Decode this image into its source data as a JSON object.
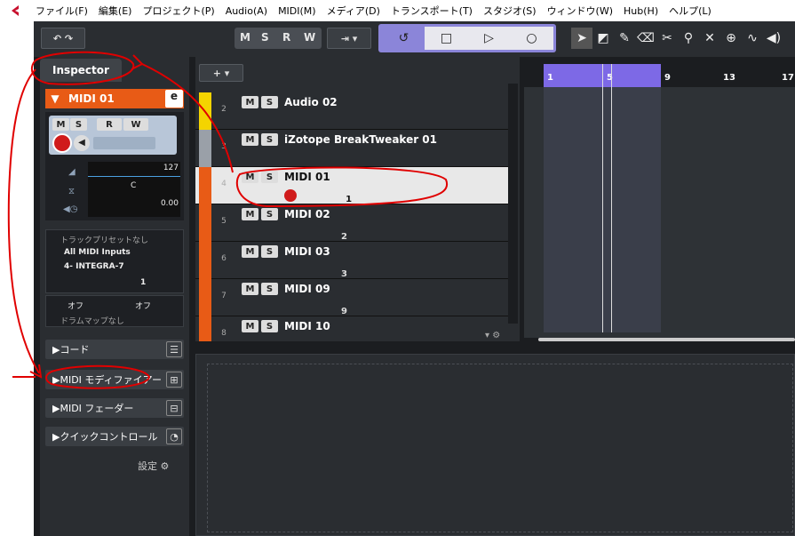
{
  "menu": [
    "ファイル(F)",
    "編集(E)",
    "プロジェクト(P)",
    "Audio(A)",
    "MIDI(M)",
    "メディア(D)",
    "トランスポート(T)",
    "スタジオ(S)",
    "ウィンドウ(W)",
    "Hub(H)",
    "ヘルプ(L)"
  ],
  "toolbar": {
    "m": "M",
    "s": "S",
    "r": "R",
    "w": "W"
  },
  "inspector": {
    "tab": "Inspector",
    "track_name": "MIDI 01",
    "vol_value": "127",
    "pan_value": "C",
    "delay_value": "0.00",
    "preset": "トラックプリセットなし",
    "input": "All MIDI Inputs",
    "output": "4- INTEGRA-7",
    "channel": "1",
    "bank": "オフ",
    "program": "オフ",
    "drummap": "ドラムマップなし",
    "sections": [
      "コード",
      "MIDI モディファイアー",
      "MIDI フェーダー",
      "クイックコントロール"
    ],
    "settings": "設定"
  },
  "tracks": [
    {
      "num": "2",
      "name": "Audio 02",
      "color": "#f4d400",
      "ch": ""
    },
    {
      "num": "3",
      "name": "iZotope BreakTweaker 01",
      "color": "#9aa0a8",
      "ch": ""
    },
    {
      "num": "4",
      "name": "MIDI 01",
      "color": "#e85b16",
      "ch": "1"
    },
    {
      "num": "5",
      "name": "MIDI 02",
      "color": "#e85b16",
      "ch": "2"
    },
    {
      "num": "6",
      "name": "MIDI 03",
      "color": "#e85b16",
      "ch": "3"
    },
    {
      "num": "7",
      "name": "MIDI 09",
      "color": "#e85b16",
      "ch": "9"
    },
    {
      "num": "8",
      "name": "MIDI 10",
      "color": "#e85b16",
      "ch": ""
    }
  ],
  "ruler": [
    "1",
    "5",
    "9",
    "13",
    "17"
  ],
  "colors": {
    "accent": "#e85b16",
    "transport": "#8b85d9",
    "annotation": "#e00000"
  }
}
